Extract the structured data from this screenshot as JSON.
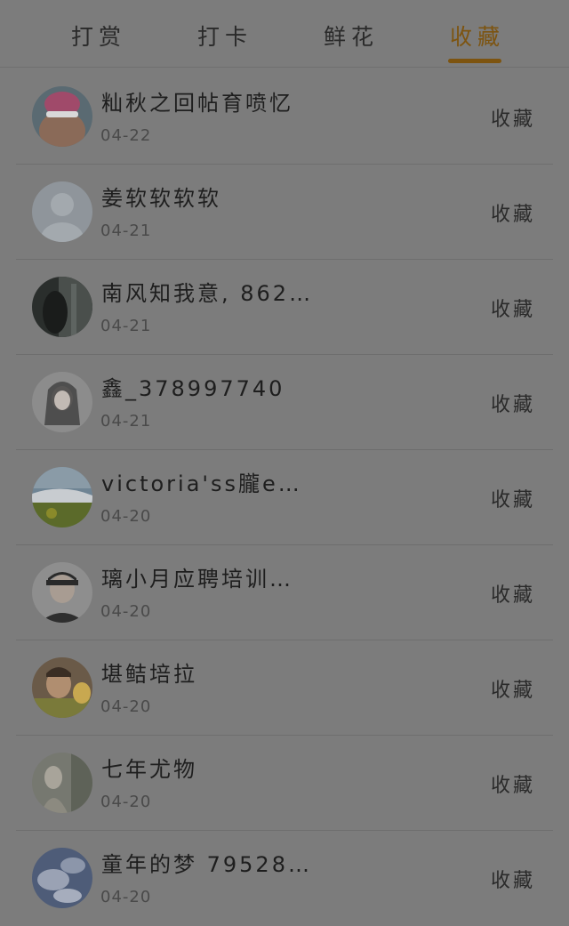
{
  "tabs": [
    {
      "label": "打赏"
    },
    {
      "label": "打卡"
    },
    {
      "label": "鲜花"
    },
    {
      "label": "收藏"
    }
  ],
  "active_tab": 3,
  "accent_color": "#7d5410",
  "items": [
    {
      "name": "籼秋之回帖育喷忆",
      "date": "04-22",
      "action": "收藏"
    },
    {
      "name": "姜软软软软",
      "date": "04-21",
      "action": "收藏"
    },
    {
      "name": "南风知我意, 862…",
      "date": "04-21",
      "action": "收藏"
    },
    {
      "name": "鑫_378997740",
      "date": "04-21",
      "action": "收藏"
    },
    {
      "name": "victoria'ss朧e…",
      "date": "04-20",
      "action": "收藏"
    },
    {
      "name": "璃小月应聘培训…",
      "date": "04-20",
      "action": "收藏"
    },
    {
      "name": "堪鲒培拉",
      "date": "04-20",
      "action": "收藏"
    },
    {
      "name": "七年尤物",
      "date": "04-20",
      "action": "收藏"
    },
    {
      "name": "童年的梦 79528…",
      "date": "04-20",
      "action": "收藏"
    }
  ]
}
